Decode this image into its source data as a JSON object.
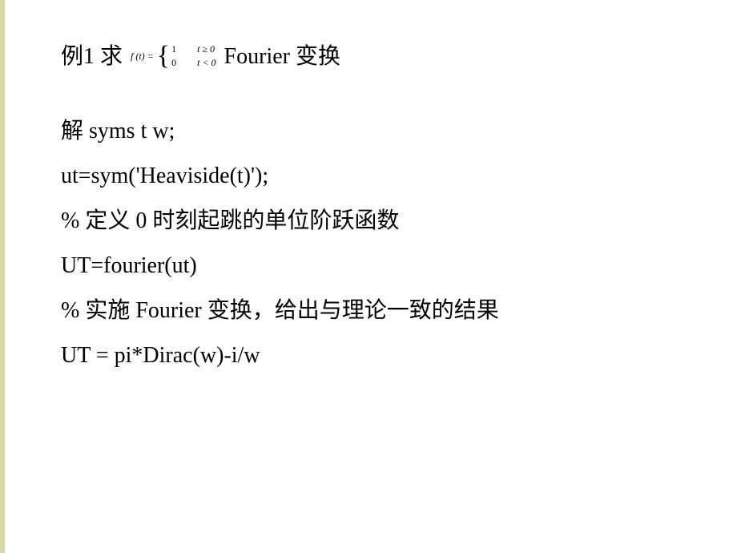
{
  "title": {
    "prefix": "例1  求",
    "formula": {
      "left": "f (t) =",
      "piece1_value": "1",
      "piece1_cond": "t ≥ 0",
      "piece2_value": "0",
      "piece2_cond": "t < 0"
    },
    "suffix": "Fourier 变换"
  },
  "lines": {
    "l1": "解   syms t w;",
    "l2": "ut=sym('Heaviside(t)');",
    "l3": "% 定义 0 时刻起跳的单位阶跃函数",
    "l4": "UT=fourier(ut)",
    "l5": "% 实施 Fourier 变换，给出与理论一致的结果",
    "l6": "UT = pi*Dirac(w)-i/w"
  }
}
